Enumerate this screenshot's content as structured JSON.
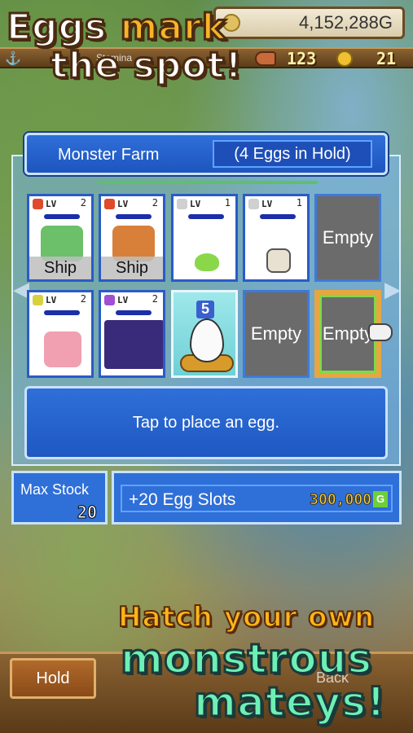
{
  "status_bar": {
    "gold": "4,152,288G",
    "stamina_label": "Stamina",
    "food": "123",
    "medals": "21"
  },
  "promo": {
    "top_line1_a": "Eggs",
    "top_line1_b": " mark",
    "top_line2": "the spot!",
    "bottom_line1": "Hatch your own",
    "bottom_line2": "monstrous",
    "bottom_line3": "mateys!"
  },
  "farm": {
    "title": "Monster Farm",
    "eggs_in_hold": "(4 Eggs in Hold)",
    "slots_row1": [
      {
        "level": "2",
        "element_color": "#e04a2a",
        "status": "Ship",
        "sprite_color": "#6cc06a"
      },
      {
        "level": "2",
        "element_color": "#e04a2a",
        "status": "Ship",
        "sprite_color": "#d8803a"
      },
      {
        "level": "1",
        "element_color": "#d0d0d0",
        "status": "",
        "sprite_color": "#8ad84a"
      },
      {
        "level": "1",
        "element_color": "#d0d0d0",
        "status": "",
        "sprite_color": "#e8e0d0"
      },
      {
        "empty_label": "Empty"
      }
    ],
    "slots_row2": [
      {
        "level": "2",
        "element_color": "#d8d040",
        "status": "",
        "sprite_color": "#f0a0b0"
      },
      {
        "level": "2",
        "element_color": "#a050d0",
        "status": "",
        "sprite_color": "#3a2a7a"
      },
      {
        "egg_number": "5"
      },
      {
        "empty_label": "Empty"
      },
      {
        "empty_label": "Empty"
      }
    ],
    "lv_label": "LV",
    "message": "Tap to place an egg."
  },
  "stock": {
    "max_stock_label": "Max Stock",
    "max_stock_value": "20",
    "expand_label": "+20 Egg Slots",
    "expand_price": "300,000",
    "currency_icon": "G"
  },
  "bottom": {
    "hold_label": "Hold",
    "back_label": "Back"
  }
}
